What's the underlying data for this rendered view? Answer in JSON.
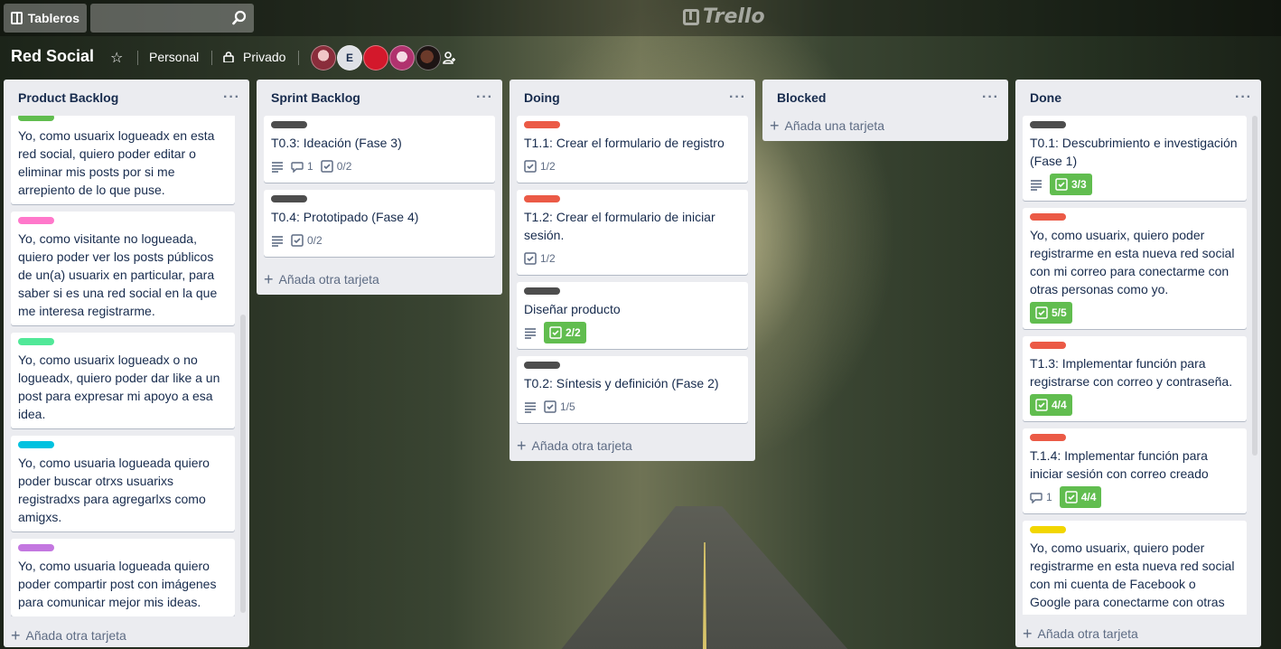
{
  "nav": {
    "boards_label": "Tableros",
    "search_placeholder": "",
    "logo_text": "Trello"
  },
  "board": {
    "title": "Red Social",
    "team": "Personal",
    "visibility": "Privado",
    "member_initial": "E"
  },
  "colors": {
    "green": "#61bd4f",
    "red": "#eb5a46",
    "black": "#4d4d4d",
    "pink": "#ff78cb",
    "lime": "#51e898",
    "sky": "#00c2e0",
    "purple": "#c377e0",
    "yellow": "#f2d600"
  },
  "lists": [
    {
      "title": "Product Backlog",
      "add_label": "Añada otra tarjeta",
      "cards": [
        {
          "label": "green",
          "title": "Yo, como usuarix logueadx en esta red social, quiero poder editar o eliminar mis posts por si me arrepiento de lo que puse."
        },
        {
          "label": "pink",
          "title": "Yo, como visitante no logueada, quiero poder ver los posts públicos de un(a) usuarix en particular, para saber si es una red social en la que me interesa registrarme."
        },
        {
          "label": "lime",
          "title": "Yo, como usuarix logueadx o no logueadx, quiero poder dar like a un post para expresar mi apoyo a esa idea."
        },
        {
          "label": "sky",
          "title": "Yo, como usuaria logueada quiero poder buscar otrxs usuarixs registradxs para agregarlxs como amigxs."
        },
        {
          "label": "purple",
          "title": "Yo, como usuaria logueada quiero poder compartir post con imágenes para comunicar mejor mis ideas."
        }
      ]
    },
    {
      "title": "Sprint Backlog",
      "add_label": "Añada otra tarjeta",
      "cards": [
        {
          "label": "black",
          "title": "T0.3: Ideación (Fase 3)",
          "comments": "1",
          "checklist": "0/2"
        },
        {
          "label": "black",
          "title": "T0.4: Prototipado (Fase 4)",
          "checklist": "0/2"
        }
      ]
    },
    {
      "title": "Doing",
      "add_label": "Añada otra tarjeta",
      "cards": [
        {
          "label": "red",
          "title": "T1.1: Crear el formulario de registro",
          "checklist": "1/2"
        },
        {
          "label": "red",
          "title": "T1.2: Crear el formulario de iniciar sesión.",
          "checklist": "1/2"
        },
        {
          "label": "black",
          "title": "Diseñar producto",
          "checklist_done": "2/2"
        },
        {
          "label": "black",
          "title": "T0.2: Síntesis y definición (Fase 2)",
          "checklist": "1/5"
        }
      ]
    },
    {
      "title": "Blocked",
      "add_label": "Añada una tarjeta",
      "cards": []
    },
    {
      "title": "Done",
      "add_label": "Añada otra tarjeta",
      "cards": [
        {
          "label": "black",
          "title": "T0.1: Descubrimiento e investigación (Fase 1)",
          "checklist_done": "3/3"
        },
        {
          "label": "red",
          "title": "Yo, como usuarix, quiero poder registrarme en esta nueva red social con mi correo para conectarme con otras personas como yo.",
          "checklist_done": "5/5"
        },
        {
          "label": "red",
          "title": "T1.3: Implementar función para registrarse con correo y contraseña.",
          "checklist_done": "4/4"
        },
        {
          "label": "red",
          "title": "T.1.4: Implementar función para iniciar sesión con correo creado",
          "comments": "1",
          "checklist_done": "4/4"
        },
        {
          "label": "yellow",
          "title": "Yo, como usuarix, quiero poder registrarme en esta nueva red social con mi cuenta de Facebook o Google para conectarme con otras personas como yo."
        }
      ]
    }
  ]
}
